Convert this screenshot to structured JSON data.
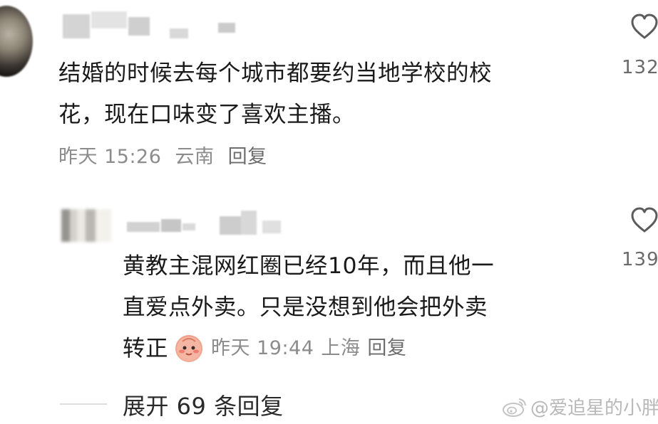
{
  "comment": {
    "text_line1": "结婚的时候去每个城市都要约当地学校的校",
    "text_line2": "花，现在口味变了喜欢主播。",
    "time": "昨天 15:26",
    "location": "云南",
    "reply_label": "回复",
    "like_count": "132"
  },
  "reply": {
    "text_line1": "黄教主混网红圈已经10年，而且他一",
    "text_line2": "直爱点外卖。只是没想到他会把外卖",
    "text_line3": "转正",
    "time": "昨天 19:44",
    "location": "上海",
    "reply_label": "回复",
    "like_count": "139"
  },
  "expand_label": "展开 69 条回复",
  "watermark": "@爱追星的小胖",
  "icons": {
    "like": "heart-outline-icon",
    "emoji": "blushing-face-emoji-icon",
    "watermark_logo": "weibo-logo-icon"
  },
  "colors": {
    "text": "#1a1a1a",
    "meta": "#8c8c8c",
    "watermark": "#b8b8b8"
  }
}
